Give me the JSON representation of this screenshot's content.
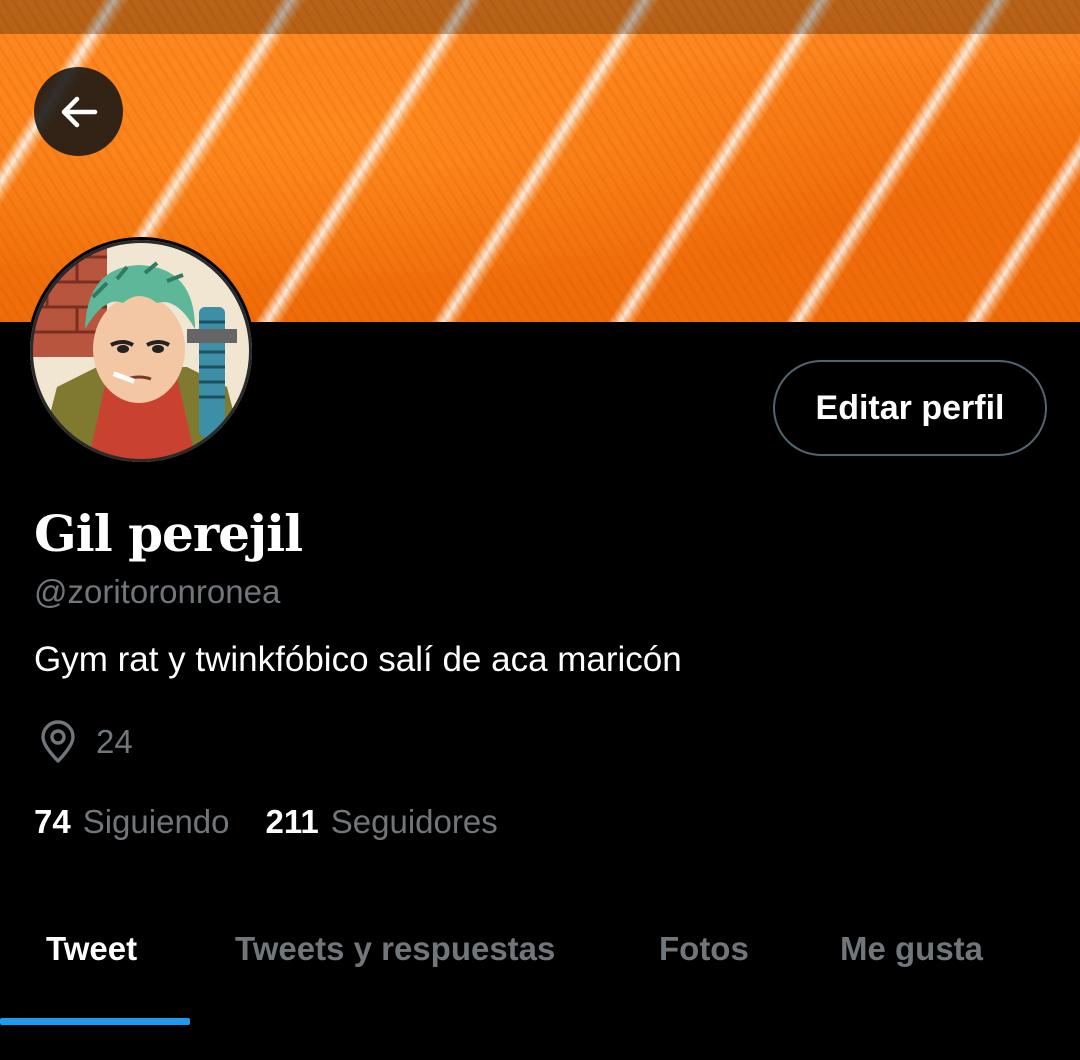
{
  "header": {
    "back_icon": "arrow-left-icon"
  },
  "profile": {
    "display_name": "Gil perejil",
    "handle": "@zoritoronronea",
    "bio": "Gym rat y twinkfóbico salí de aca maricón",
    "location_icon": "location-pin-icon",
    "location": "24",
    "edit_button": "Editar perfil"
  },
  "stats": {
    "following_count": "74",
    "following_label": "Siguiendo",
    "followers_count": "211",
    "followers_label": "Seguidores"
  },
  "tabs": [
    {
      "label": "Tweet",
      "active": true
    },
    {
      "label": "Tweets y respuestas",
      "active": false
    },
    {
      "label": "Fotos",
      "active": false
    },
    {
      "label": "Me gusta",
      "active": false
    }
  ],
  "colors": {
    "background": "#000000",
    "banner": "#f4760f",
    "muted_text": "#71767b",
    "accent": "#1d9bf0",
    "border": "#536471"
  }
}
